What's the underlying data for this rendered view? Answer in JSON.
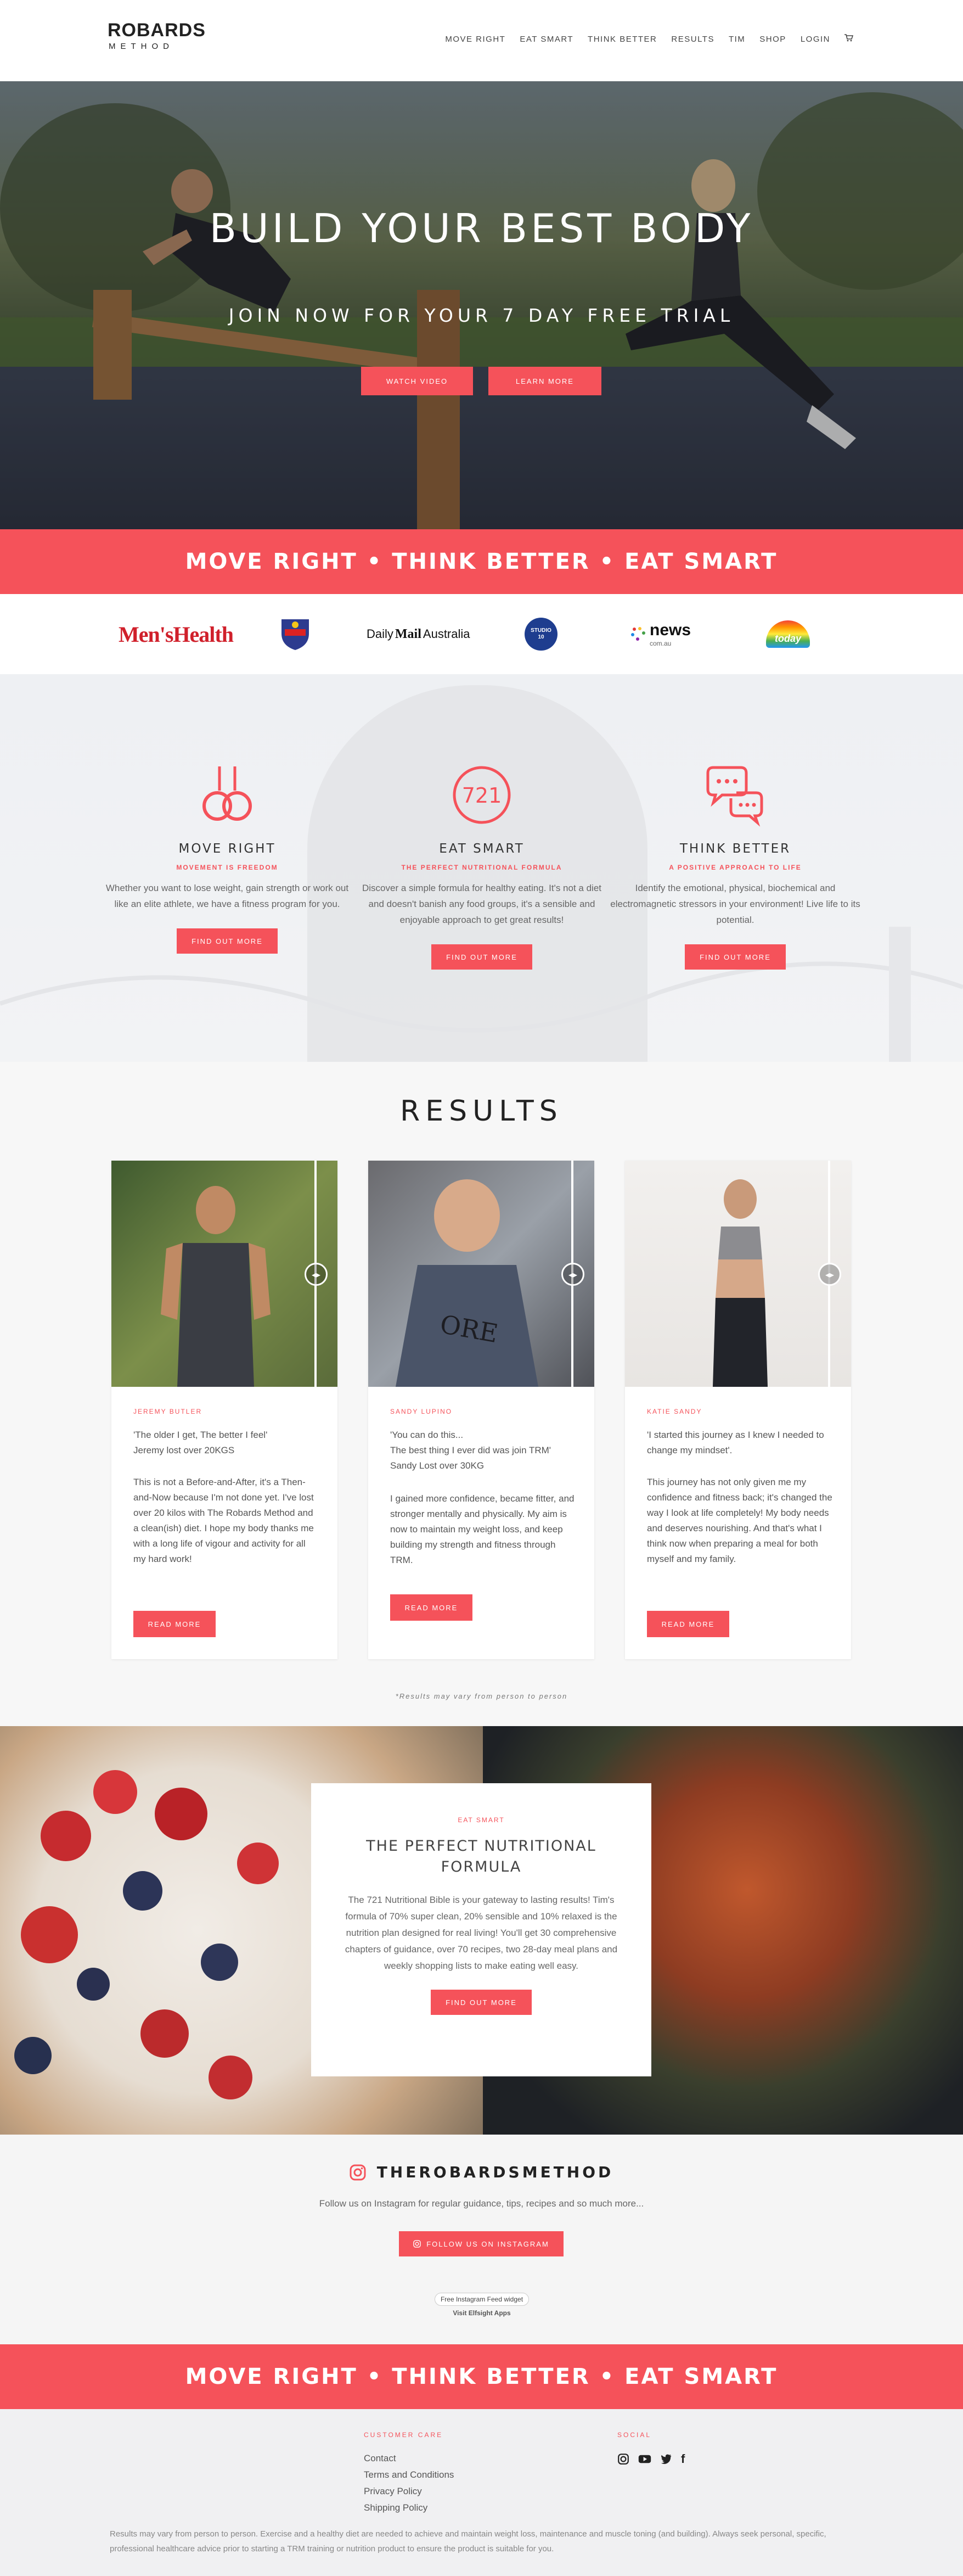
{
  "header": {
    "logo_line1": "ROBARDS",
    "logo_line2": "METHOD",
    "nav": [
      "MOVE RIGHT",
      "EAT SMART",
      "THINK BETTER",
      "RESULTS",
      "TIM",
      "SHOP",
      "LOGIN"
    ],
    "cart_icon": "cart-icon"
  },
  "hero": {
    "title": "BUILD YOUR BEST BODY",
    "subtitle": "JOIN NOW FOR YOUR 7 DAY FREE TRIAL",
    "watch_label": "WATCH VIDEO",
    "learn_label": "LEARN MORE"
  },
  "banner_text": "MOVE RIGHT • THINK BETTER • EAT SMART",
  "press": {
    "mens_health": "Men'sHealth",
    "daily_mail_1": "Daily",
    "daily_mail_2": "Mail",
    "daily_mail_3": "Australia",
    "studio10": "STUDIO 10",
    "news": "news",
    "news_sub": "com.au",
    "today": "today"
  },
  "pillars": [
    {
      "title": "MOVE RIGHT",
      "sub": "MOVEMENT IS FREEDOM",
      "desc": "Whether you want to lose weight, gain strength or work out like an elite athlete, we have a fitness program for you.",
      "btn": "FIND OUT MORE",
      "icon": "rings-icon"
    },
    {
      "title": "EAT SMART",
      "sub": "THE PERFECT NUTRITIONAL FORMULA",
      "desc": "Discover a simple formula for healthy eating. It's not a diet and doesn't banish any food groups, it's a sensible and enjoyable approach to get great results!",
      "btn": "FIND OUT MORE",
      "icon": "721-icon",
      "icon_text": "721"
    },
    {
      "title": "THINK BETTER",
      "sub": "A POSITIVE APPROACH TO LIFE",
      "desc": "Identify the emotional, physical, biochemical and electromagnetic stressors in your environment! Live life to its potential.",
      "btn": "FIND OUT MORE",
      "icon": "chat-bubbles-icon"
    }
  ],
  "results": {
    "title": "RESULTS",
    "cards": [
      {
        "name": "JEREMY BUTLER",
        "quote": "'The older I get, The better I feel'\nJeremy lost over 20KGS",
        "story": "This is not a Before-and-After, it's a Then-and-Now because I'm not done yet. I've lost over 20 kilos with The Robards Method and a clean(ish) diet. I hope my body thanks me with a long life of vigour and activity for all my hard work!",
        "btn": "READ MORE"
      },
      {
        "name": "SANDY LUPINO",
        "quote": "'You can do this...\nThe best thing I ever did was join TRM'\nSandy Lost over 30KG",
        "story": "I gained more confidence, became fitter, and stronger mentally and physically. My aim is now to maintain my weight loss, and keep building my strength and fitness through TRM.",
        "btn": "READ MORE",
        "shirt_text": "ORE"
      },
      {
        "name": "KATIE SANDY",
        "quote": "'I started this journey as I knew I needed to change my mindset'.",
        "story": "This journey has not only given me my confidence and fitness back; it's changed the way I look at life completely! My body needs and deserves nourishing. And that's what I think now when preparing a meal for both myself and my family.",
        "btn": "READ MORE"
      }
    ],
    "disclaimer": "*Results may vary from person to person"
  },
  "food": {
    "eyebrow": "EAT SMART",
    "title": "THE PERFECT NUTRITIONAL FORMULA",
    "desc": "The 721 Nutritional Bible is your gateway to lasting results! Tim's formula of 70% super clean, 20% sensible and 10% relaxed is the nutrition plan designed for real living! You'll get 30 comprehensive chapters of guidance, over 70 recipes, two 28-day meal plans and weekly shopping lists to make eating well easy.",
    "btn": "FIND OUT MORE"
  },
  "instagram": {
    "handle": "THEROBARDSMETHOD",
    "desc": "Follow us on Instagram for regular guidance, tips, recipes and so much more...",
    "btn": "FOLLOW US ON INSTAGRAM",
    "widget_pill": "Free Instagram Feed widget",
    "widget_link": "Visit Elfsight Apps"
  },
  "footer": {
    "customer_care_title": "CUSTOMER CARE",
    "links": [
      "Contact",
      "Terms and Conditions",
      "Privacy Policy",
      "Shipping Policy"
    ],
    "social_title": "SOCIAL",
    "social_icons": [
      "instagram-icon",
      "youtube-icon",
      "twitter-icon",
      "facebook-icon"
    ],
    "social_facebook": "f",
    "note": "Results may vary from person to person. Exercise and a healthy diet are needed to achieve and maintain weight loss, maintenance and muscle toning (and building). Always seek personal, specific, professional healthcare advice prior to starting a TRM training or nutrition product to ensure the product is suitable for you."
  },
  "colors": {
    "accent": "#f5525a",
    "text": "#555555",
    "background": "#ffffff"
  }
}
